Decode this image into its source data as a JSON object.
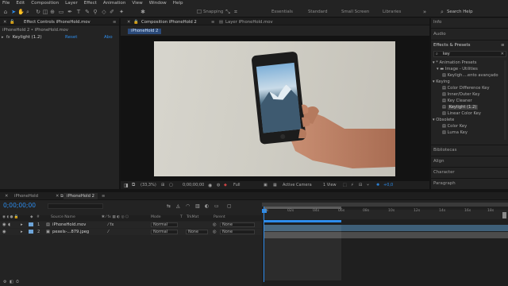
{
  "menu": [
    "File",
    "Edit",
    "Composition",
    "Layer",
    "Effect",
    "Animation",
    "View",
    "Window",
    "Help"
  ],
  "toolbar": {
    "snapping_label": "Snapping",
    "workspaces": [
      "Essentials",
      "Standard",
      "Small Screen",
      "Libraries"
    ],
    "search_placeholder": "Search Help"
  },
  "left_panel": {
    "tab_label": "Effect Controls iPhoneHold.mov",
    "breadcrumb": "iPhoneHold 2 • iPhoneHold.mov",
    "effect_name": "Keylight (1.2)",
    "reset_label": "Reset",
    "about_label": "Abo"
  },
  "composition": {
    "tab_label": "Composition iPhoneHold 2",
    "layer_tab_label": "Layer iPhoneHold.mov",
    "subtab_label": "iPhoneHold 2"
  },
  "viewer_footer": {
    "zoom": "(33,3%)",
    "timecode": "0;00;00;00",
    "resolution": "Full",
    "camera": "Active Camera",
    "views": "1 View",
    "exposure": "+0,0"
  },
  "right_panel": {
    "info": "Info",
    "audio": "Audio",
    "effects_title": "Effects & Presets",
    "search_value": "key",
    "tree": [
      {
        "label": "* Animation Presets",
        "level": 0
      },
      {
        "label": "Image - Utilities",
        "level": 1
      },
      {
        "label": "Keyligh....ento avançado",
        "level": 2
      },
      {
        "label": "Keying",
        "level": 0
      },
      {
        "label": "Color Difference Key",
        "level": 2
      },
      {
        "label": "Inner/Outer Key",
        "level": 2
      },
      {
        "label": "Key Cleaner",
        "level": 2
      },
      {
        "label": "Keylight (1.2)",
        "level": 2,
        "selected": true
      },
      {
        "label": "Linear Color Key",
        "level": 2
      },
      {
        "label": "Obsolete",
        "level": 0
      },
      {
        "label": "Color Key",
        "level": 2
      },
      {
        "label": "Luma Key",
        "level": 2
      }
    ],
    "sections": [
      "Bibliotecas",
      "Align",
      "Character",
      "Paragraph"
    ]
  },
  "timeline": {
    "tabs": [
      "iPhoneHold",
      "iPhoneHold 2"
    ],
    "current_time": "0;00;00;00",
    "columns": {
      "source": "Source Name",
      "mode": "Mode",
      "t": "T",
      "trkmat": "TrkMat",
      "parent": "Parent"
    },
    "layers": [
      {
        "num": "1",
        "name": "iPhoneHold.mov",
        "mode": "Normal",
        "trkmat": "",
        "parent": "None"
      },
      {
        "num": "2",
        "name": "pexels-...879.jpeg",
        "mode": "Normal",
        "trkmat": "None",
        "parent": "None"
      }
    ],
    "ruler": [
      "0s",
      "02s",
      "04s",
      "06s",
      "08s",
      "10s",
      "12s",
      "14s",
      "16s",
      "18s"
    ],
    "work_area_end_fraction": 0.33
  },
  "colors": {
    "accent": "#2d8ceb",
    "panel": "#232323",
    "bg": "#1b1b1b",
    "selection": "#2b4a7a"
  }
}
